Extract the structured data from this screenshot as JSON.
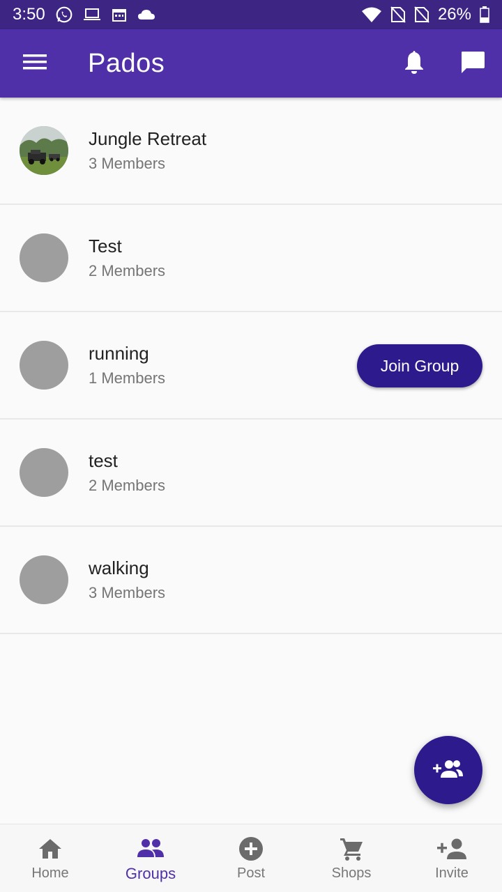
{
  "status_bar": {
    "time": "3:50",
    "battery": "26%"
  },
  "app_bar": {
    "title": "Pados"
  },
  "groups": [
    {
      "name": "Jungle Retreat",
      "members": "3 Members",
      "avatar": "photo"
    },
    {
      "name": "Test",
      "members": "2 Members",
      "avatar": "placeholder"
    },
    {
      "name": "running",
      "members": "1 Members",
      "avatar": "placeholder",
      "action": "Join Group"
    },
    {
      "name": "test",
      "members": "2 Members",
      "avatar": "placeholder"
    },
    {
      "name": "walking",
      "members": "3 Members",
      "avatar": "placeholder"
    }
  ],
  "bottom_nav": {
    "items": [
      {
        "label": "Home",
        "icon": "home-icon"
      },
      {
        "label": "Groups",
        "icon": "groups-icon",
        "active": true
      },
      {
        "label": "Post",
        "icon": "add-circle-icon"
      },
      {
        "label": "Shops",
        "icon": "cart-icon"
      },
      {
        "label": "Invite",
        "icon": "person-add-icon"
      }
    ]
  },
  "colors": {
    "status_bar": "#3d2584",
    "app_bar": "#5030a8",
    "accent": "#2d1a8c",
    "avatar_placeholder": "#9e9e9e"
  }
}
